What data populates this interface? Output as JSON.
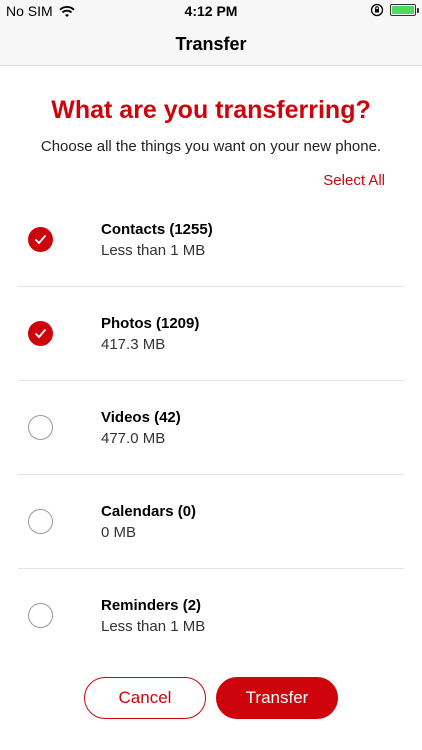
{
  "status_bar": {
    "carrier": "No SIM",
    "time": "4:12 PM",
    "battery_level": 1.0,
    "icons": [
      "wifi-icon",
      "orientation-lock-icon",
      "battery-icon"
    ]
  },
  "nav": {
    "title": "Transfer"
  },
  "main": {
    "heading": "What are you transferring?",
    "subtitle": "Choose all the things you want on your new phone.",
    "select_all": "Select All"
  },
  "items": [
    {
      "title": "Contacts (1255)",
      "size": "Less than 1 MB",
      "checked": true
    },
    {
      "title": "Photos (1209)",
      "size": "417.3 MB",
      "checked": true
    },
    {
      "title": "Videos (42)",
      "size": "477.0 MB",
      "checked": false
    },
    {
      "title": "Calendars (0)",
      "size": "0 MB",
      "checked": false
    },
    {
      "title": "Reminders (2)",
      "size": "Less than 1 MB",
      "checked": false
    }
  ],
  "buttons": {
    "cancel": "Cancel",
    "transfer": "Transfer"
  },
  "colors": {
    "accent": "#cd040b",
    "battery": "#4cd964"
  }
}
